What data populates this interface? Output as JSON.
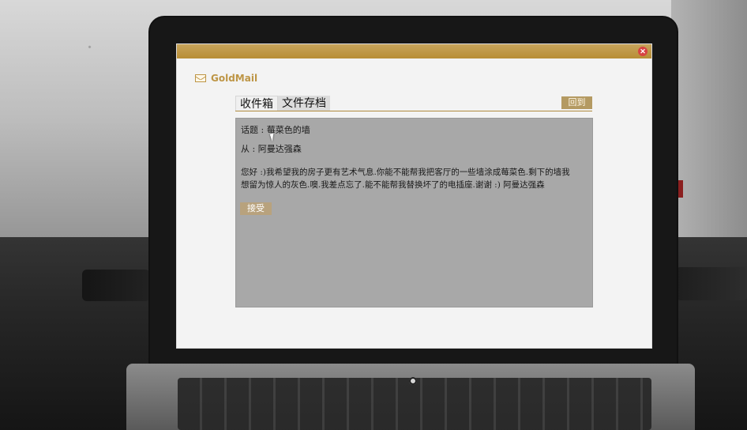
{
  "window": {
    "brand_name": "GoldMail",
    "close_icon": "✕"
  },
  "tabs": {
    "inbox": "收件箱",
    "archive": "文件存档"
  },
  "toolbar": {
    "reply_label": "回到"
  },
  "message": {
    "subject_line": "话题 : 莓菜色的墙",
    "from_line": "从 : 阿曼达强森",
    "body": "您好 :)我希望我的房子更有艺术气息.你能不能帮我把客厅的一些墙涂成莓菜色.剩下的墙我想留为惊人的灰色.噢.我差点忘了.能不能帮我替换坏了的电插座.谢谢 :) 阿曼达强森",
    "accept_label": "接受"
  },
  "colors": {
    "accent_gold": "#b88d35",
    "panel_gray": "#a8a8a8",
    "close_red": "#d74343"
  }
}
